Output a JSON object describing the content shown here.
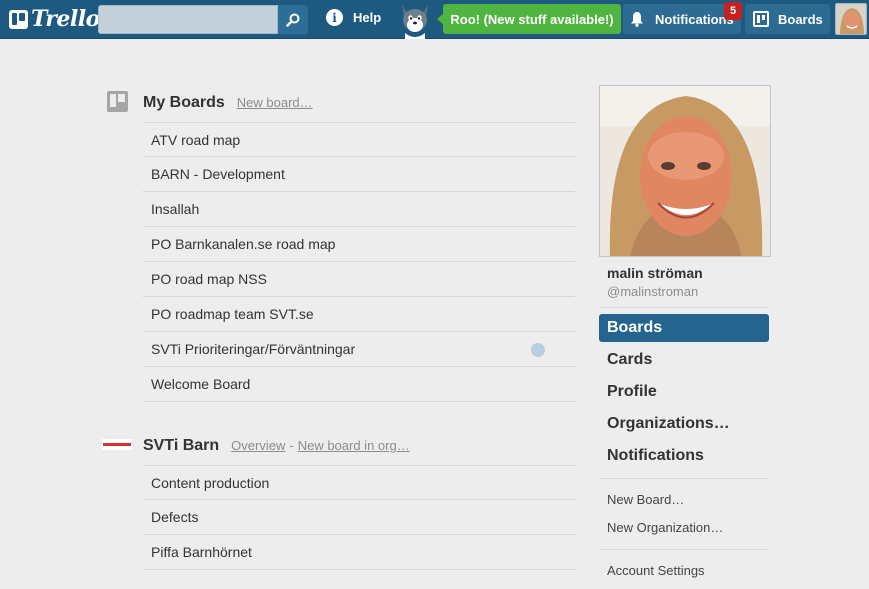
{
  "header": {
    "logo_text": "Trello",
    "search": {
      "value": "",
      "placeholder": ""
    },
    "help_label": "Help",
    "roo_message": "Roo! (New stuff available!)",
    "notifications_label": "Notifications",
    "notifications_count": "5",
    "boards_label": "Boards"
  },
  "my_boards": {
    "title": "My Boards",
    "new_board_link": "New board…",
    "items": [
      {
        "label": "ATV road map"
      },
      {
        "label": "BARN - Development"
      },
      {
        "label": "Insallah"
      },
      {
        "label": "PO Barnkanalen.se road map"
      },
      {
        "label": "PO road map NSS"
      },
      {
        "label": "PO roadmap team SVT.se"
      },
      {
        "label": "SVTi Prioriteringar/Förväntningar"
      },
      {
        "label": "Welcome Board"
      }
    ]
  },
  "org_boards": {
    "title": "SVTi Barn",
    "overview_link": "Overview",
    "separator": "-",
    "new_board_link": "New board in org…",
    "items": [
      {
        "label": "Content production"
      },
      {
        "label": "Defects"
      },
      {
        "label": "Piffa Barnhörnet"
      }
    ]
  },
  "sidebar": {
    "name": "malin ströman",
    "username": "@malinstroman",
    "nav": [
      {
        "label": "Boards",
        "active": true
      },
      {
        "label": "Cards"
      },
      {
        "label": "Profile"
      },
      {
        "label": "Organizations…"
      },
      {
        "label": "Notifications"
      }
    ],
    "links": [
      {
        "label": "New Board…"
      },
      {
        "label": "New Organization…"
      }
    ],
    "account_settings": "Account Settings"
  },
  "colors": {
    "header_bg": "#1e5a80",
    "roo_green": "#4fb540",
    "badge_red": "#c82020",
    "active_nav": "#24648f"
  }
}
